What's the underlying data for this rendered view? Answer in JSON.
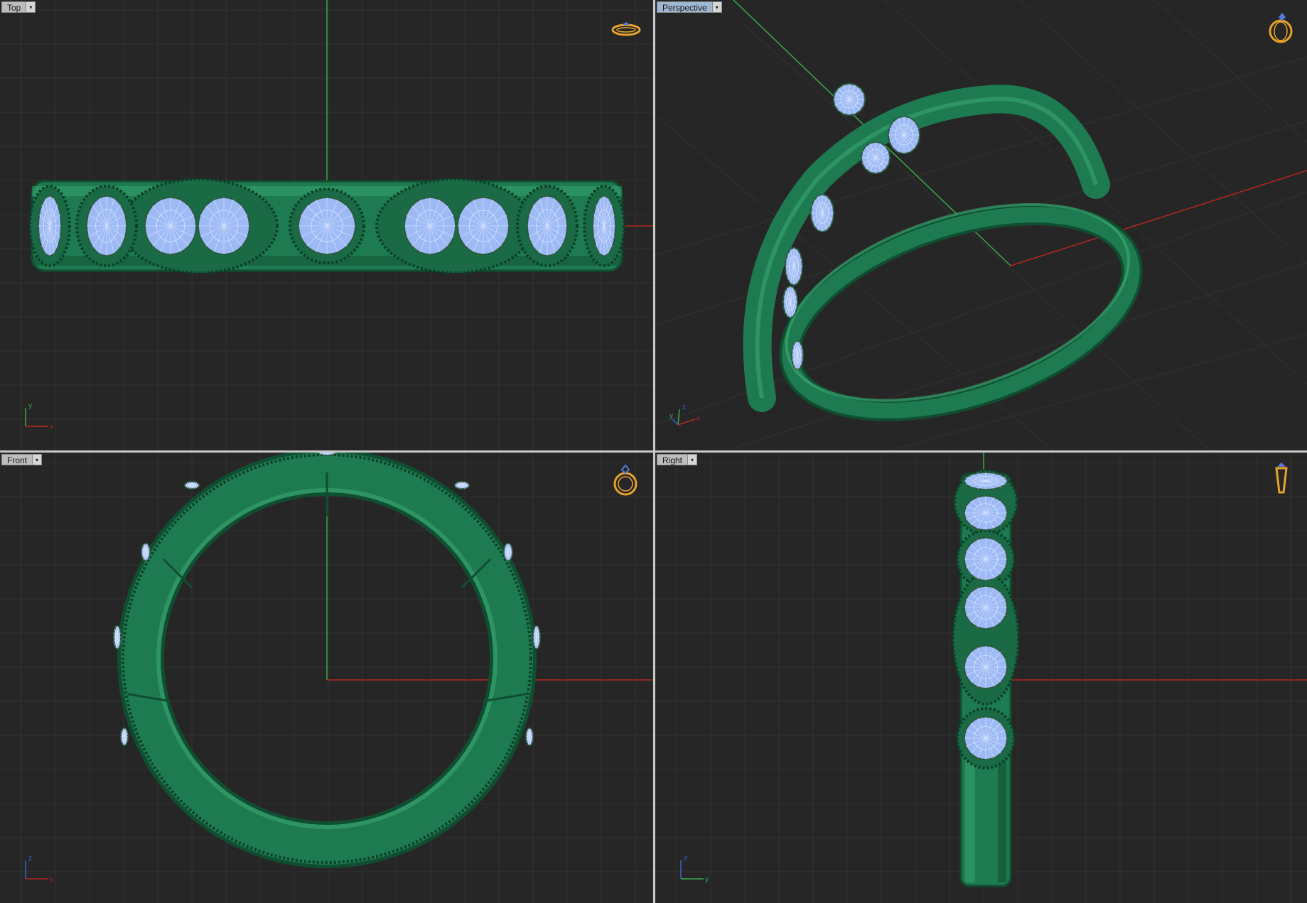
{
  "viewports": {
    "top": {
      "label": "Top",
      "axes": [
        "y",
        "x"
      ],
      "nav_icon": "ring-side-icon"
    },
    "perspective": {
      "label": "Perspective",
      "axes": [
        "z",
        "y",
        "x"
      ],
      "nav_icon": "ring-perspective-icon"
    },
    "front": {
      "label": "Front",
      "axes": [
        "z",
        "x"
      ],
      "nav_icon": "ring-front-icon"
    },
    "right": {
      "label": "Right",
      "axes": [
        "z",
        "y"
      ],
      "nav_icon": "ring-right-icon"
    }
  },
  "colors": {
    "background": "#262626",
    "grid": "#333333",
    "x_axis": "#b3261e",
    "y_axis": "#3aa84a",
    "metal": "#1e7a50",
    "metal_dark": "#0f4e31",
    "metal_light": "#3fae77",
    "gem": "#9dbaf5",
    "gem_line": "#d9e4ff",
    "nav_icon": "#e6a32a",
    "active_tab": "#9fb7d3"
  },
  "dropdown_glyph": "▾"
}
